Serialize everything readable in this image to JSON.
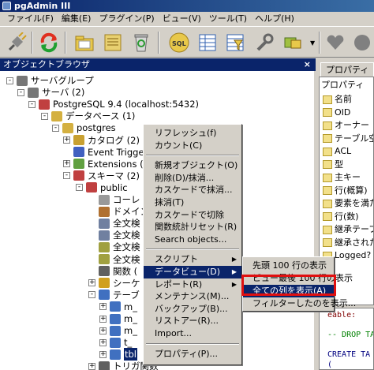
{
  "window": {
    "title": "pgAdmin III"
  },
  "menu": [
    "ファイル(F)",
    "編集(E)",
    "プラグイン(P)",
    "ビュー(V)",
    "ツール(T)",
    "ヘルプ(H)"
  ],
  "toolbar": {
    "icons": [
      "plug-icon",
      "refresh-icon",
      "open-folder-icon",
      "delete-icon",
      "sql-icon",
      "table-view-icon",
      "properties-icon",
      "wrench-icon",
      "plugins-icon",
      "heart-icon",
      "question-icon"
    ]
  },
  "browser": {
    "title": "オブジェクトブラウザ",
    "close": "×"
  },
  "tree": [
    {
      "label": "サーバグループ",
      "level": 0,
      "exp": "-",
      "color": "#777"
    },
    {
      "label": "サーバ (2)",
      "level": 1,
      "exp": "-",
      "color": "#777"
    },
    {
      "label": "PostgreSQL 9.4 (localhost:5432)",
      "level": 2,
      "exp": "-",
      "color": "#c04040"
    },
    {
      "label": "データベース (1)",
      "level": 3,
      "exp": "-",
      "color": "#d4b040"
    },
    {
      "label": "postgres",
      "level": 4,
      "exp": "-",
      "color": "#d4b040"
    },
    {
      "label": "カタログ (2)",
      "level": 5,
      "exp": "+",
      "color": "#c8a030"
    },
    {
      "label": "Event Trigge",
      "level": 5,
      "exp": "",
      "color": "#4060c0"
    },
    {
      "label": "Extensions (2",
      "level": 5,
      "exp": "+",
      "color": "#60a040"
    },
    {
      "label": "スキーマ (2)",
      "level": 5,
      "exp": "-",
      "color": "#c04040"
    },
    {
      "label": "public",
      "level": 6,
      "exp": "-",
      "color": "#c04040"
    },
    {
      "label": "コーレ",
      "level": 7,
      "exp": "",
      "color": "#999"
    },
    {
      "label": "ドメイン",
      "level": 7,
      "exp": "",
      "color": "#b07030"
    },
    {
      "label": "全文検",
      "level": 7,
      "exp": "",
      "color": "#7080a0"
    },
    {
      "label": "全文検",
      "level": 7,
      "exp": "",
      "color": "#7080a0"
    },
    {
      "label": "全文検",
      "level": 7,
      "exp": "",
      "color": "#a0a040"
    },
    {
      "label": "全文検",
      "level": 7,
      "exp": "",
      "color": "#a0a040"
    },
    {
      "label": "関数 (",
      "level": 7,
      "exp": "",
      "color": "#606060"
    },
    {
      "label": "シーケ",
      "level": 7,
      "exp": "+",
      "color": "#d0a020"
    },
    {
      "label": "テーブ",
      "level": 7,
      "exp": "-",
      "color": "#4070c0"
    },
    {
      "label": "m_",
      "level": 8,
      "exp": "+",
      "color": "#4070c0"
    },
    {
      "label": "m_",
      "level": 8,
      "exp": "+",
      "color": "#4070c0"
    },
    {
      "label": "m_",
      "level": 8,
      "exp": "+",
      "color": "#4070c0"
    },
    {
      "label": "t_",
      "level": 8,
      "exp": "+",
      "color": "#4070c0"
    },
    {
      "label": "tbl",
      "level": 8,
      "exp": "+",
      "color": "#4070c0",
      "selected": true
    },
    {
      "label": "トリガ関数",
      "level": 7,
      "exp": "+",
      "color": "#606060"
    }
  ],
  "context_menu": {
    "items": [
      "リフレッシュ(f)",
      "カウント(C)",
      "",
      "新規オブジェクト(O)",
      "削除(D)/抹消...",
      "カスケードで抹消...",
      "抹消(T)",
      "カスケードで切除",
      "関数統計リセット(R)",
      "Search objects...",
      "",
      "スクリプト",
      "データビュー(D)",
      "レポート(R)",
      "メンテナンス(M)...",
      "バックアップ(B)...",
      "リストアー(R)...",
      "Import...",
      "",
      "プロパティ(P)..."
    ],
    "submenu_items": [
      "スクリプト",
      "データビュー(D)",
      "レポート(R)"
    ],
    "selected": "データビュー(D)"
  },
  "submenu": {
    "items": [
      "先頭 100 行の表示",
      "ビュー最後 100 行の表示",
      "全ての列を表示(A)",
      "フィルターしたのを表示..."
    ],
    "selected": "全ての列を表示(A)"
  },
  "properties": {
    "tab": "プロパティ",
    "header": "プロパティ",
    "rows": [
      "名前",
      "OID",
      "オーナー",
      "テーブル空間",
      "ACL",
      "型",
      "主キー",
      "行(概算)",
      "要素を満たす",
      "行(数)",
      "継承テーブル",
      "継承された",
      "Logged?"
    ]
  },
  "sql": {
    "lines": [
      "eable:",
      "",
      "-- DROP TA",
      "",
      "CREATE TA",
      "("
    ]
  }
}
